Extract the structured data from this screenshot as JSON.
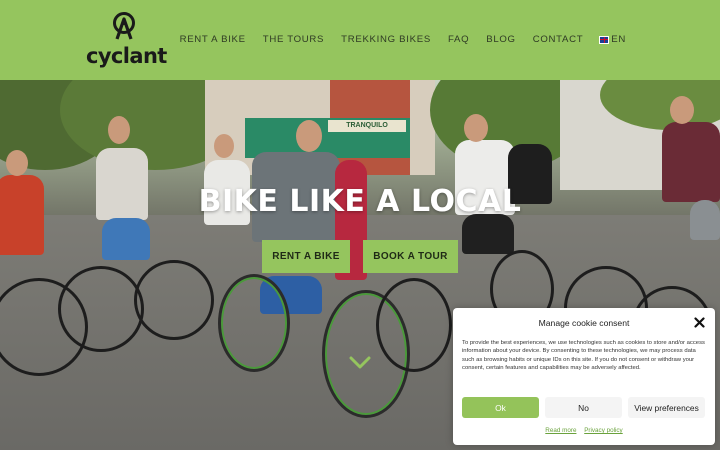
{
  "brand": {
    "name": "cyclant"
  },
  "nav": {
    "items": [
      {
        "label": "RENT A BIKE"
      },
      {
        "label": "THE TOURS"
      },
      {
        "label": "TREKKING BIKES"
      },
      {
        "label": "FAQ"
      },
      {
        "label": "BLOG"
      },
      {
        "label": "CONTACT"
      }
    ],
    "language": "EN"
  },
  "hero": {
    "title": "BIKE LIKE A LOCAL",
    "shop_sign": "TRANQUILO",
    "buttons": {
      "rent": "RENT A BIKE",
      "tour": "BOOK A TOUR"
    }
  },
  "cookie": {
    "title": "Manage cookie consent",
    "text": "To provide the best experiences, we use technologies such as cookies to store and/or access information about your device. By consenting to these technologies, we may process data such as browsing habits or unique IDs on this site. If you do not consent or withdraw your consent, certain features and capabilities may be adversely affected.",
    "ok": "Ok",
    "no": "No",
    "preferences": "View preferences",
    "read_more": "Read more",
    "privacy_policy": "Privacy policy"
  },
  "colors": {
    "accent": "#95c55e",
    "header_bg": "#95c55e",
    "title": "#ffffff"
  }
}
